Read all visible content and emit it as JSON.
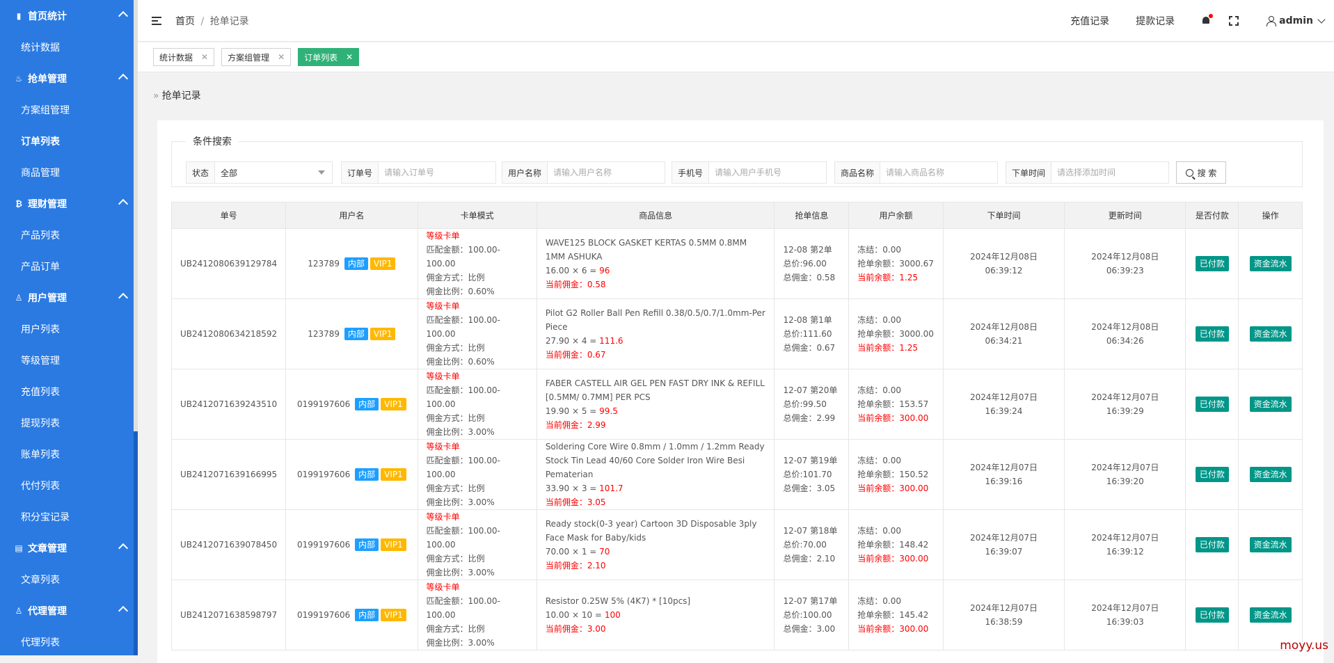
{
  "sidebar": {
    "groups": [
      {
        "label": "首页统计",
        "icon": "bar-chart-icon",
        "items": [
          "统计数据"
        ]
      },
      {
        "label": "抢单管理",
        "icon": "fire-icon",
        "items": [
          "方案组管理",
          "订单列表",
          "商品管理"
        ]
      },
      {
        "label": "理财管理",
        "icon": "bitcoin-icon",
        "items": [
          "产品列表",
          "产品订单"
        ]
      },
      {
        "label": "用户管理",
        "icon": "user-icon",
        "items": [
          "用户列表",
          "等级管理",
          "充值列表",
          "提现列表",
          "账单列表",
          "代付列表",
          "积分宝记录"
        ]
      },
      {
        "label": "文章管理",
        "icon": "document-icon",
        "items": [
          "文章列表"
        ]
      },
      {
        "label": "代理管理",
        "icon": "agent-icon",
        "items": [
          "代理列表"
        ]
      }
    ],
    "active_item": "订单列表"
  },
  "header": {
    "breadcrumb_home": "首页",
    "breadcrumb_sep": "/",
    "breadcrumb_current": "抢单记录",
    "recharge_link": "充值记录",
    "withdraw_link": "提款记录",
    "username": "admin"
  },
  "tabs": [
    {
      "label": "统计数据",
      "active": false
    },
    {
      "label": "方案组管理",
      "active": false
    },
    {
      "label": "订单列表",
      "active": true
    }
  ],
  "page_title": "抢单记录",
  "search": {
    "legend": "条件搜索",
    "status_label": "状态",
    "status_value": "全部",
    "order_label": "订单号",
    "order_placeholder": "请输入订单号",
    "username_label": "用户名称",
    "username_placeholder": "请输入用户名称",
    "phone_label": "手机号",
    "phone_placeholder": "请输入用户手机号",
    "product_label": "商品名称",
    "product_placeholder": "请输入商品名称",
    "time_label": "下单时间",
    "time_placeholder": "请选择添加时间",
    "button": "搜 索"
  },
  "table": {
    "headers": [
      "单号",
      "用户名",
      "卡单模式",
      "商品信息",
      "抢单信息",
      "用户余额",
      "下单时间",
      "更新时间",
      "是否付款",
      "操作"
    ],
    "rows": [
      {
        "id": "UB2412080639129784",
        "user": "123789",
        "tag1": "内部",
        "tag2": "VIP1",
        "mode": "等级卡单",
        "match": "匹配金额：100.00-100.00",
        "comm_type": "佣金方式：比例",
        "comm_rate": "佣金比例：0.60%",
        "product_name": "WAVE125 BLOCK GASKET KERTAS 0.5MM 0.8MM 1MM ASHUKA",
        "calc": "16.00 × 6 = ",
        "total": "96",
        "cur_comm_label": "当前佣金：",
        "cur_comm": "0.58",
        "grab1": "12-08 第2单",
        "grab2": "总价:96.00",
        "grab3": "总佣金：0.58",
        "bal1": "冻结：0.00",
        "bal2": "抢单余额：3000.67",
        "bal3_label": "当前余额：",
        "bal3": "1.25",
        "order_time": "2024年12月08日 06:39:12",
        "update_time": "2024年12月08日 06:39:23",
        "paid": "已付款",
        "action": "资金流水"
      },
      {
        "id": "UB2412080634218592",
        "user": "123789",
        "tag1": "内部",
        "tag2": "VIP1",
        "mode": "等级卡单",
        "match": "匹配金额：100.00-100.00",
        "comm_type": "佣金方式：比例",
        "comm_rate": "佣金比例：0.60%",
        "product_name": "Pilot G2 Roller Ball Pen Refill 0.38/0.5/0.7/1.0mm-Per Piece",
        "calc": "27.90 × 4 = ",
        "total": "111.6",
        "cur_comm_label": "当前佣金：",
        "cur_comm": "0.67",
        "grab1": "12-08 第1单",
        "grab2": "总价:111.60",
        "grab3": "总佣金：0.67",
        "bal1": "冻结：0.00",
        "bal2": "抢单余额：3000.00",
        "bal3_label": "当前余额：",
        "bal3": "1.25",
        "order_time": "2024年12月08日 06:34:21",
        "update_time": "2024年12月08日 06:34:26",
        "paid": "已付款",
        "action": "资金流水"
      },
      {
        "id": "UB2412071639243510",
        "user": "0199197606",
        "tag1": "内部",
        "tag2": "VIP1",
        "mode": "等级卡单",
        "match": "匹配金额：100.00-100.00",
        "comm_type": "佣金方式：比例",
        "comm_rate": "佣金比例：3.00%",
        "product_name": "FABER CASTELL AIR GEL PEN FAST DRY INK & REFILL [0.5MM/ 0.7MM] PER PCS",
        "calc": "19.90 × 5 = ",
        "total": "99.5",
        "cur_comm_label": "当前佣金：",
        "cur_comm": "2.99",
        "grab1": "12-07 第20单",
        "grab2": "总价:99.50",
        "grab3": "总佣金：2.99",
        "bal1": "冻结：0.00",
        "bal2": "抢单余额：153.57",
        "bal3_label": "当前余额：",
        "bal3": "300.00",
        "order_time": "2024年12月07日 16:39:24",
        "update_time": "2024年12月07日 16:39:29",
        "paid": "已付款",
        "action": "资金流水"
      },
      {
        "id": "UB2412071639166995",
        "user": "0199197606",
        "tag1": "内部",
        "tag2": "VIP1",
        "mode": "等级卡单",
        "match": "匹配金额：100.00-100.00",
        "comm_type": "佣金方式：比例",
        "comm_rate": "佣金比例：3.00%",
        "product_name": "Soldering Core Wire 0.8mm / 1.0mm / 1.2mm Ready Stock Tin Lead 40/60 Core Solder Iron Wire Besi Pematerian",
        "calc": "33.90 × 3 = ",
        "total": "101.7",
        "cur_comm_label": "当前佣金：",
        "cur_comm": "3.05",
        "grab1": "12-07 第19单",
        "grab2": "总价:101.70",
        "grab3": "总佣金：3.05",
        "bal1": "冻结：0.00",
        "bal2": "抢单余额：150.52",
        "bal3_label": "当前余额：",
        "bal3": "300.00",
        "order_time": "2024年12月07日 16:39:16",
        "update_time": "2024年12月07日 16:39:20",
        "paid": "已付款",
        "action": "资金流水"
      },
      {
        "id": "UB2412071639078450",
        "user": "0199197606",
        "tag1": "内部",
        "tag2": "VIP1",
        "mode": "等级卡单",
        "match": "匹配金额：100.00-100.00",
        "comm_type": "佣金方式：比例",
        "comm_rate": "佣金比例：3.00%",
        "product_name": "Ready stock(0-3 year) Cartoon 3D Disposable 3ply Face Mask for Baby/kids",
        "calc": "70.00 × 1 = ",
        "total": "70",
        "cur_comm_label": "当前佣金：",
        "cur_comm": "2.10",
        "grab1": "12-07 第18单",
        "grab2": "总价:70.00",
        "grab3": "总佣金：2.10",
        "bal1": "冻结：0.00",
        "bal2": "抢单余额：148.42",
        "bal3_label": "当前余额：",
        "bal3": "300.00",
        "order_time": "2024年12月07日 16:39:07",
        "update_time": "2024年12月07日 16:39:12",
        "paid": "已付款",
        "action": "资金流水"
      },
      {
        "id": "UB2412071638598797",
        "user": "0199197606",
        "tag1": "内部",
        "tag2": "VIP1",
        "mode": "等级卡单",
        "match": "匹配金额：100.00-100.00",
        "comm_type": "佣金方式：比例",
        "comm_rate": "佣金比例：3.00%",
        "product_name": "Resistor 0.25W 5% (4K7) * [10pcs]",
        "calc": "10.00 × 10 = ",
        "total": "100",
        "cur_comm_label": "当前佣金：",
        "cur_comm": "3.00",
        "grab1": "12-07 第17单",
        "grab2": "总价:100.00",
        "grab3": "总佣金：3.00",
        "bal1": "冻结：0.00",
        "bal2": "抢单余额：145.42",
        "bal3_label": "当前余额：",
        "bal3": "300.00",
        "order_time": "2024年12月07日 16:38:59",
        "update_time": "2024年12月07日 16:39:03",
        "paid": "已付款",
        "action": "资金流水"
      }
    ]
  },
  "watermark": "moyy.us"
}
